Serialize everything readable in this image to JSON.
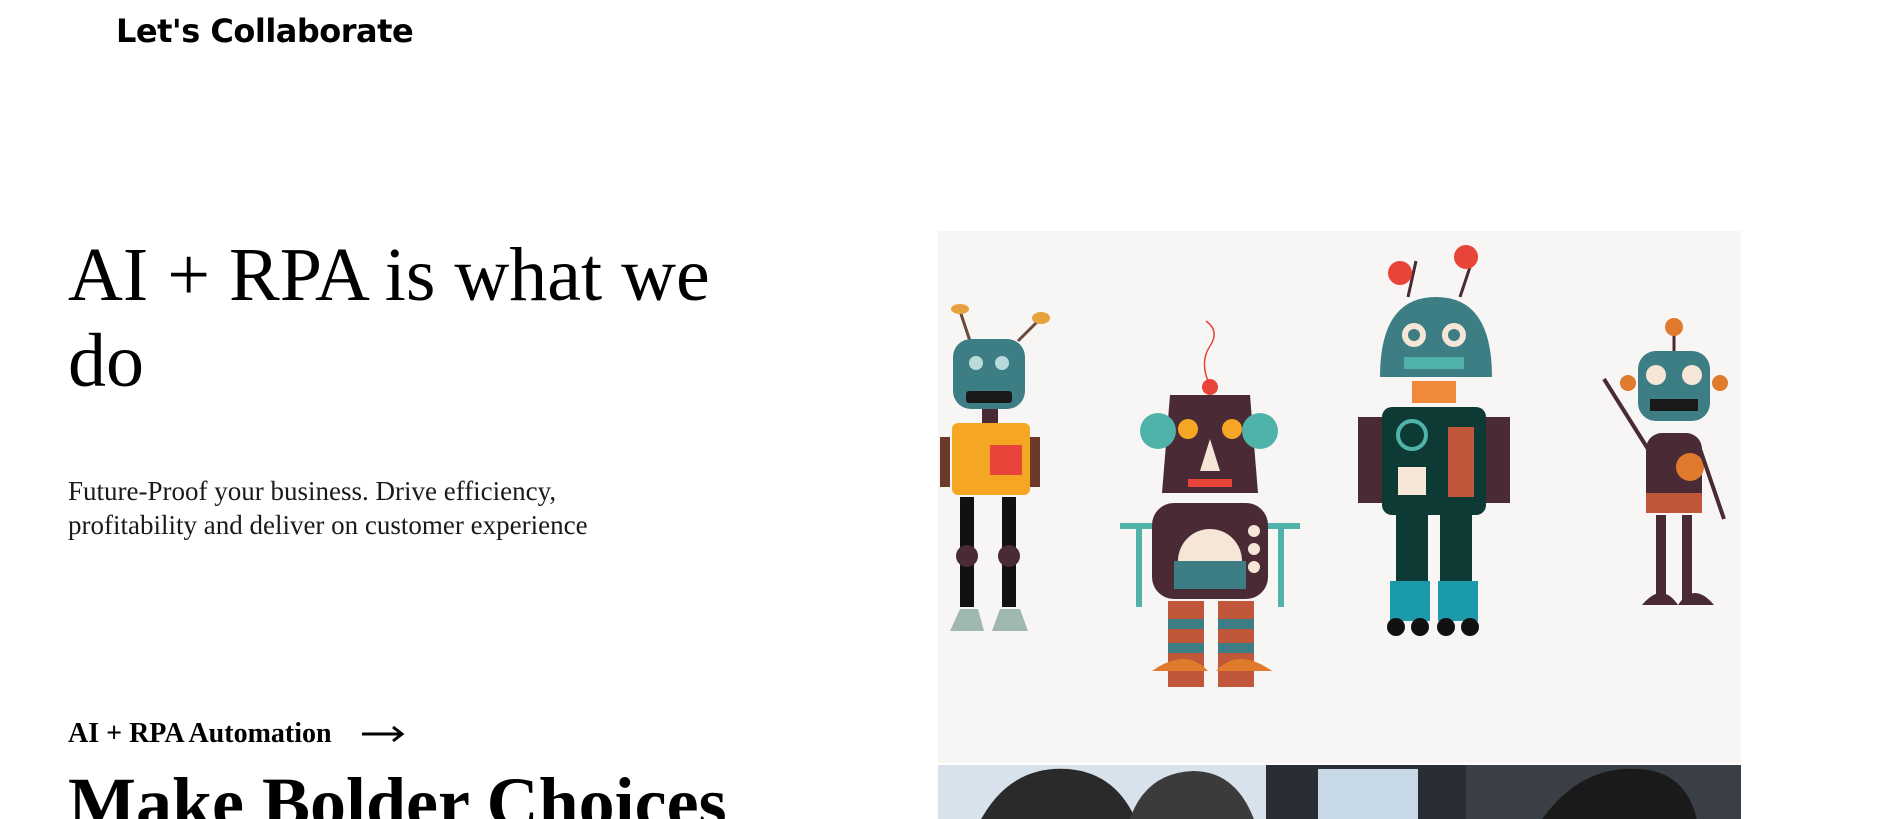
{
  "header": {
    "collab_link": "Let's Collaborate"
  },
  "hero": {
    "title": "AI + RPA is what we do",
    "subtitle": "Future-Proof your business. Drive efficiency, profitability and deliver on customer experience"
  },
  "section": {
    "link_label": "AI + RPA Automation",
    "heading": "Make Bolder Choices"
  },
  "images": {
    "robots": "robots-illustration",
    "people": "team-photo"
  },
  "colors": {
    "text": "#000000",
    "image_bg": "#f8f6f4",
    "robot_teal": "#3d7e84",
    "robot_orange": "#f5a623",
    "robot_plum": "#4a2b35",
    "robot_red": "#e8443a"
  }
}
